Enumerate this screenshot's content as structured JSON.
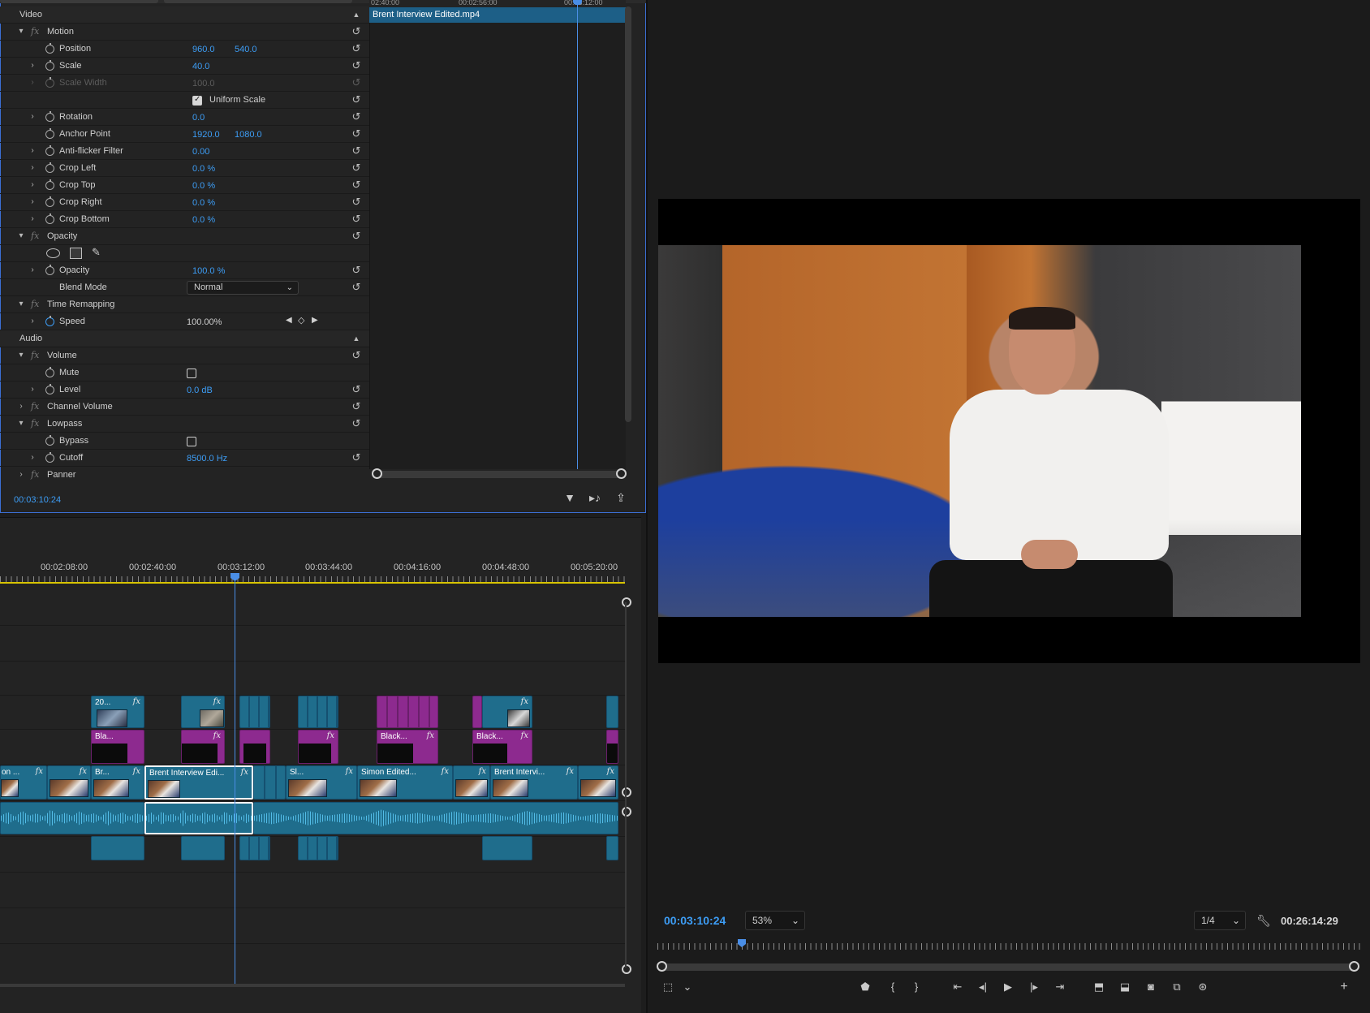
{
  "effect_controls": {
    "clip_name": "Brent Interview Edited.mp4",
    "ruler_labels": [
      "02:40:00",
      "00:02:56:00",
      "00:03:12:00"
    ],
    "timecode": "00:03:10:24",
    "sections": {
      "video": "Video",
      "audio": "Audio"
    },
    "rows": {
      "motion": "Motion",
      "position": {
        "label": "Position",
        "x": "960.0",
        "y": "540.0"
      },
      "scale": {
        "label": "Scale",
        "value": "40.0"
      },
      "scale_width": {
        "label": "Scale Width",
        "value": "100.0"
      },
      "uniform_scale": {
        "label": "Uniform Scale",
        "checked": true
      },
      "rotation": {
        "label": "Rotation",
        "value": "0.0"
      },
      "anchor_point": {
        "label": "Anchor Point",
        "x": "1920.0",
        "y": "1080.0"
      },
      "anti_flicker": {
        "label": "Anti-flicker Filter",
        "value": "0.00"
      },
      "crop_left": {
        "label": "Crop Left",
        "value": "0.0 %"
      },
      "crop_top": {
        "label": "Crop Top",
        "value": "0.0 %"
      },
      "crop_right": {
        "label": "Crop Right",
        "value": "0.0 %"
      },
      "crop_bottom": {
        "label": "Crop Bottom",
        "value": "0.0 %"
      },
      "opacity_group": "Opacity",
      "opacity": {
        "label": "Opacity",
        "value": "100.0 %"
      },
      "blend_mode": {
        "label": "Blend Mode",
        "value": "Normal"
      },
      "time_remapping": "Time Remapping",
      "speed": {
        "label": "Speed",
        "value": "100.00%"
      },
      "volume": "Volume",
      "mute": {
        "label": "Mute",
        "checked": false
      },
      "level": {
        "label": "Level",
        "value": "0.0 dB"
      },
      "channel_volume": "Channel Volume",
      "lowpass": "Lowpass",
      "bypass": {
        "label": "Bypass",
        "checked": false
      },
      "cutoff": {
        "label": "Cutoff",
        "value": "8500.0 Hz"
      },
      "panner": "Panner"
    }
  },
  "timeline": {
    "ruler_labels": [
      "00:02:08:00",
      "00:02:40:00",
      "00:03:12:00",
      "00:03:44:00",
      "00:04:16:00",
      "00:04:48:00",
      "00:05:20:00"
    ],
    "v3_clips": [
      "20...",
      "Bla...",
      "Black...",
      "Black..."
    ],
    "v1_clips": [
      "on ...",
      "Br...",
      "Brent Interview Edi...",
      "Sl...",
      "Simon Edited...",
      "Brent Intervi..."
    ],
    "fx_label": "fx"
  },
  "program_monitor": {
    "timecode": "00:03:10:24",
    "zoom": "53%",
    "resolution": "1/4",
    "duration": "00:26:14:29",
    "accent_color": "#3d9df5"
  }
}
